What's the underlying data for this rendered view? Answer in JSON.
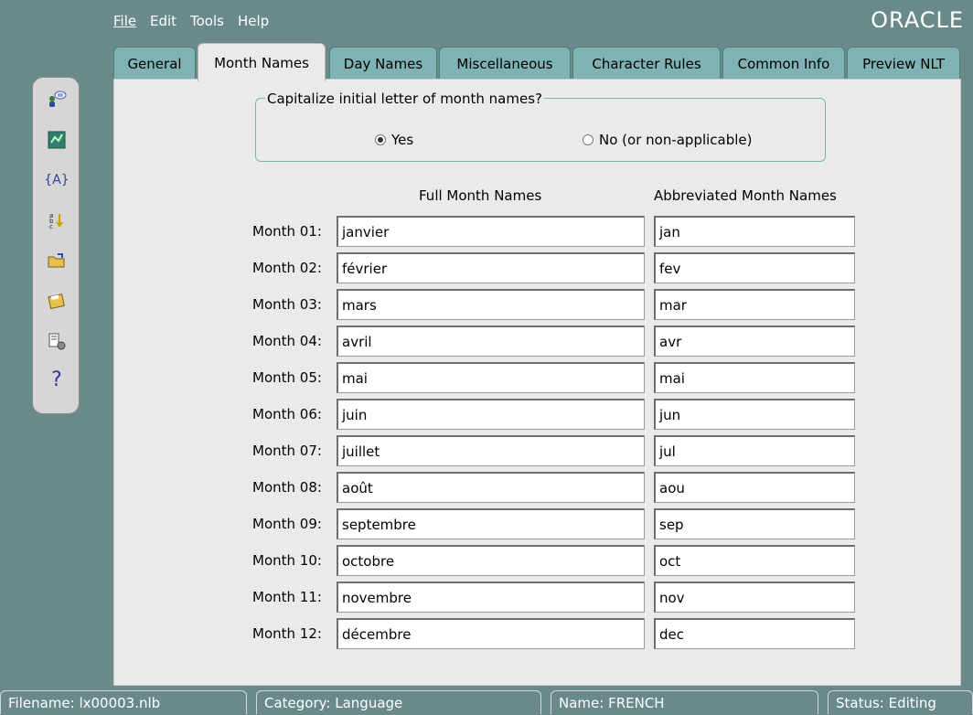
{
  "menu": {
    "file": "File",
    "edit": "Edit",
    "tools": "Tools",
    "help": "Help",
    "logo": "ORACLE"
  },
  "tabs": [
    {
      "label": "General"
    },
    {
      "label": "Month Names"
    },
    {
      "label": "Day Names"
    },
    {
      "label": "Miscellaneous"
    },
    {
      "label": "Character Rules"
    },
    {
      "label": "Common Info"
    },
    {
      "label": "Preview NLT"
    }
  ],
  "toolbar": {
    "icons": [
      "users-chat-icon",
      "map-icon",
      "braces-a-icon",
      "sort-abc-icon",
      "open-folder-icon",
      "save-disk-icon",
      "settings-list-icon",
      "help-question-icon"
    ]
  },
  "capitalize": {
    "title": "Capitalize initial letter of month names?",
    "yes": "Yes",
    "no": "No (or non-applicable)",
    "selected": "yes"
  },
  "columns": {
    "full": "Full Month Names",
    "abbr": "Abbreviated Month Names"
  },
  "months": [
    {
      "label": "Month 01:",
      "full": "janvier",
      "abbr": "jan"
    },
    {
      "label": "Month 02:",
      "full": "février",
      "abbr": "fev"
    },
    {
      "label": "Month 03:",
      "full": "mars",
      "abbr": "mar"
    },
    {
      "label": "Month 04:",
      "full": "avril",
      "abbr": "avr"
    },
    {
      "label": "Month 05:",
      "full": "mai",
      "abbr": "mai"
    },
    {
      "label": "Month 06:",
      "full": "juin",
      "abbr": "jun"
    },
    {
      "label": "Month 07:",
      "full": "juillet",
      "abbr": "jul"
    },
    {
      "label": "Month 08:",
      "full": "août",
      "abbr": "aou"
    },
    {
      "label": "Month 09:",
      "full": "septembre",
      "abbr": "sep"
    },
    {
      "label": "Month 10:",
      "full": "octobre",
      "abbr": "oct"
    },
    {
      "label": "Month 11:",
      "full": "novembre",
      "abbr": "nov"
    },
    {
      "label": "Month 12:",
      "full": "décembre",
      "abbr": "dec"
    }
  ],
  "status": {
    "filename": "Filename: lx00003.nlb",
    "category": "Category: Language",
    "name": "Name: FRENCH",
    "state": "Status: Editing"
  },
  "colors": {
    "background": "#6a8a8a",
    "tab": "#7fb2b2",
    "panel": "#eaeaea"
  }
}
